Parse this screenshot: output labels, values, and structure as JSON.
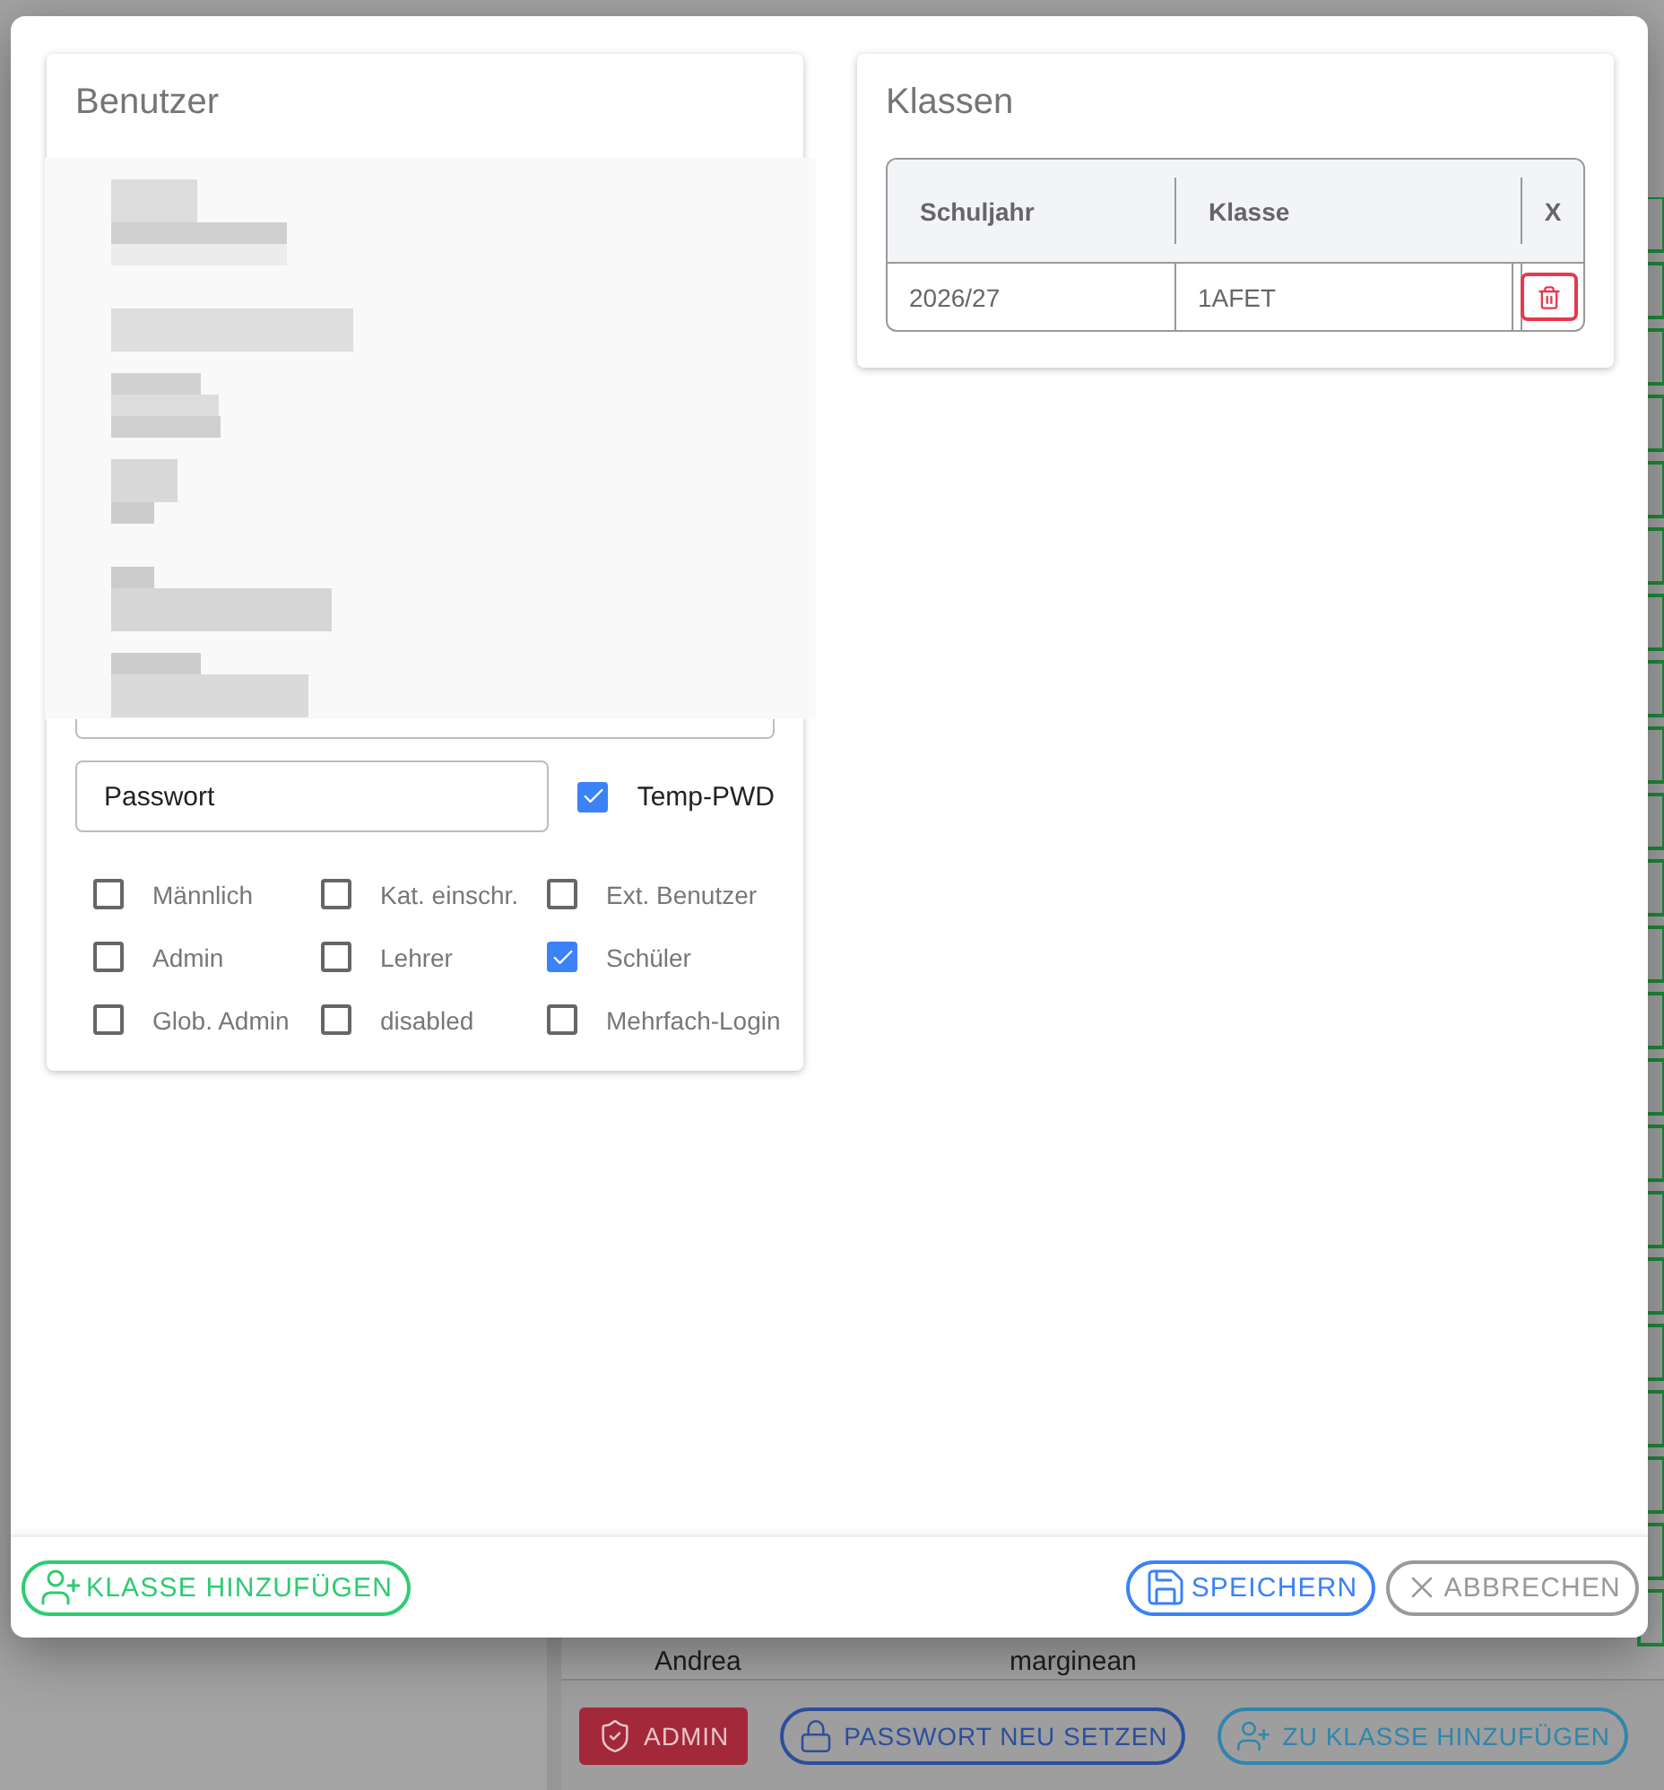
{
  "modal": {
    "user_card": {
      "title": "Benutzer",
      "password": {
        "placeholder": "Passwort"
      },
      "temp_pwd": {
        "label": "Temp-PWD",
        "checked": true
      },
      "flags": [
        {
          "label": "Männlich",
          "checked": false
        },
        {
          "label": "Kat. einschr.",
          "checked": false
        },
        {
          "label": "Ext. Benutzer",
          "checked": false
        },
        {
          "label": "Admin",
          "checked": false
        },
        {
          "label": "Lehrer",
          "checked": false
        },
        {
          "label": "Schüler",
          "checked": true
        },
        {
          "label": "Glob. Admin",
          "checked": false
        },
        {
          "label": "disabled",
          "checked": false
        },
        {
          "label": "Mehrfach-Login",
          "checked": false
        }
      ]
    },
    "classes_card": {
      "title": "Klassen",
      "table": {
        "columns": [
          "Schuljahr",
          "Klasse",
          "X"
        ],
        "rows": [
          {
            "cells": [
              "2026/27",
              "1AFET"
            ]
          }
        ]
      }
    },
    "footer": {
      "left_buttons": [
        {
          "label": "KLASSE HINZUFÜGEN",
          "kind": "add-class"
        }
      ],
      "right_buttons": [
        {
          "label": "SPEICHERN",
          "kind": "save"
        },
        {
          "label": "ABBRECHEN",
          "kind": "cancel"
        }
      ]
    }
  },
  "background": {
    "list_row": [
      "Andrea",
      "marginean"
    ],
    "actions": [
      {
        "label": "ADMIN",
        "kind": "admin"
      },
      {
        "label": "PASSWORT NEU SETZEN",
        "kind": "password"
      },
      {
        "label": "ZU KLASSE HINZUFÜGEN",
        "kind": "add-to-class"
      }
    ]
  }
}
